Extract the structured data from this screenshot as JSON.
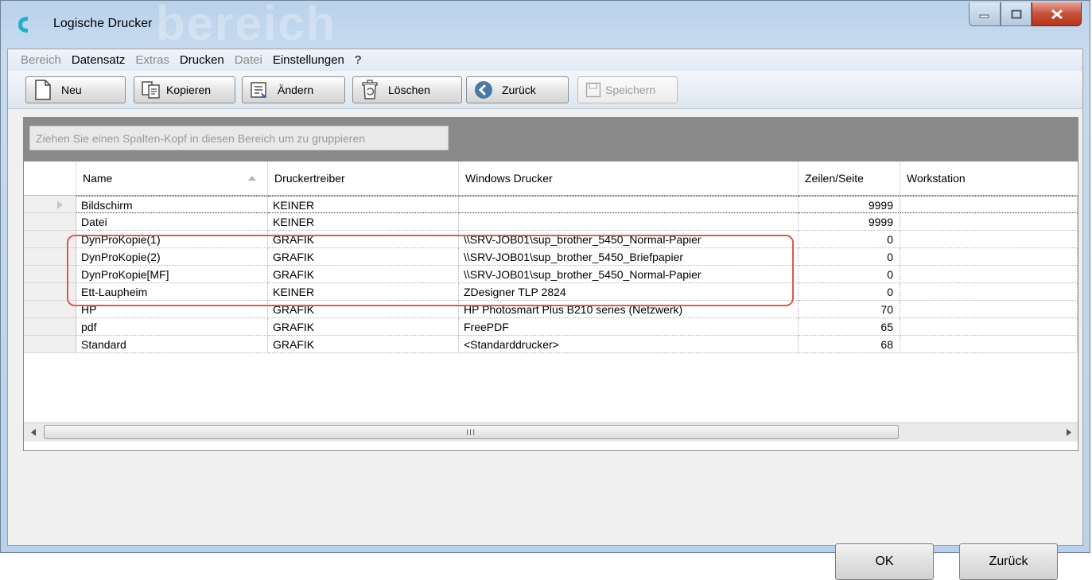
{
  "window": {
    "title": "Logische Drucker",
    "watermark": "bereich"
  },
  "menu": [
    "Bereich",
    "Datensatz",
    "Extras",
    "Drucken",
    "Datei",
    "Einstellungen",
    "?"
  ],
  "toolbar": {
    "new_label": "Neu",
    "copy_label": "Kopieren",
    "edit_label": "Ändern",
    "delete_label": "Löschen",
    "back_label": "Zurück",
    "save_label": "Speichern"
  },
  "grid": {
    "group_hint": "Ziehen Sie einen Spalten-Kopf in diesen Bereich um zu gruppieren",
    "columns": [
      "Name",
      "Druckertreiber",
      "Windows Drucker",
      "Zeilen/Seite",
      "Workstation"
    ],
    "rows": [
      [
        "Bildschirm",
        "KEINER",
        "",
        "9999",
        ""
      ],
      [
        "Datei",
        "KEINER",
        "",
        "9999",
        ""
      ],
      [
        "DynProKopie(1)",
        "GRAFIK",
        "\\\\SRV-JOB01\\sup_brother_5450_Normal-Papier",
        "0",
        ""
      ],
      [
        "DynProKopie(2)",
        "GRAFIK",
        "\\\\SRV-JOB01\\sup_brother_5450_Briefpapier",
        "0",
        ""
      ],
      [
        "DynProKopie[MF]",
        "GRAFIK",
        "\\\\SRV-JOB01\\sup_brother_5450_Normal-Papier",
        "0",
        ""
      ],
      [
        "Ett-Laupheim",
        "KEINER",
        "ZDesigner TLP 2824",
        "0",
        ""
      ],
      [
        "HP",
        "GRAFIK",
        "HP Photosmart Plus B210 series (Netzwerk)",
        "70",
        ""
      ],
      [
        "pdf",
        "GRAFIK",
        "FreePDF",
        "65",
        ""
      ],
      [
        "Standard",
        "GRAFIK",
        "<Standarddrucker>",
        "68",
        ""
      ]
    ],
    "scroll_grip": "III"
  },
  "footer": {
    "ok_label": "OK",
    "back_label": "Zurück"
  },
  "colors": {
    "highlight": "#e0584f",
    "group_panel": "#8a8a8a"
  }
}
